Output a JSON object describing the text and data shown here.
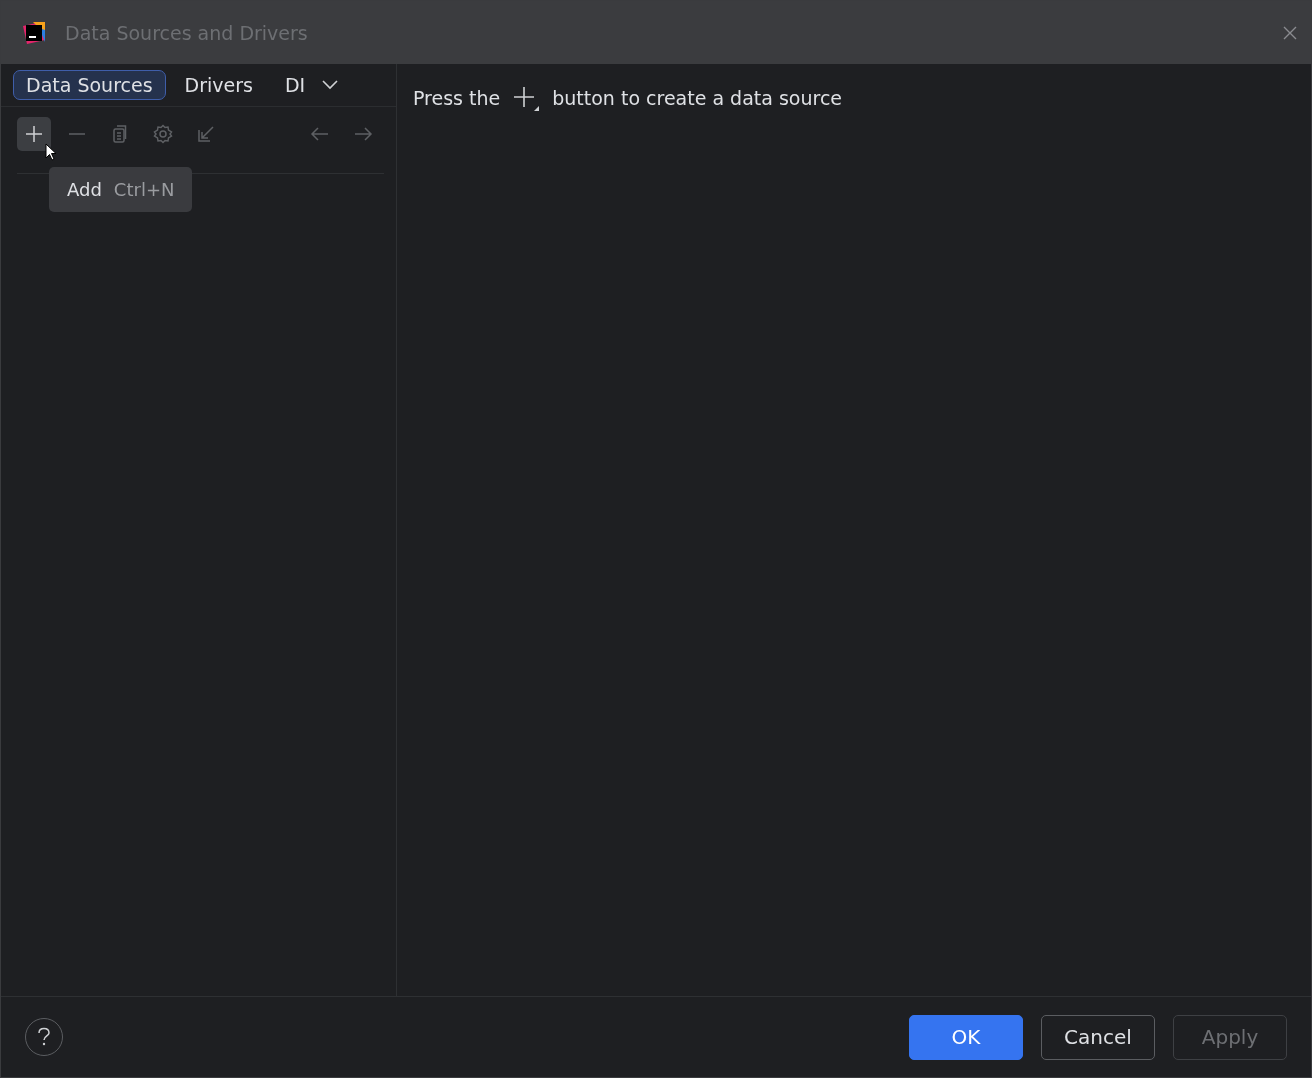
{
  "window": {
    "title": "Data Sources and Drivers"
  },
  "tabs": [
    {
      "label": "Data Sources",
      "selected": true
    },
    {
      "label": "Drivers",
      "selected": false
    },
    {
      "label": "DI",
      "selected": false
    }
  ],
  "toolbar": [
    {
      "kind": "add",
      "disabled": false,
      "hovered": true
    },
    {
      "kind": "remove",
      "disabled": true,
      "hovered": false
    },
    {
      "kind": "copy",
      "disabled": true,
      "hovered": false
    },
    {
      "kind": "settings",
      "disabled": true,
      "hovered": false
    },
    {
      "kind": "import",
      "disabled": true,
      "hovered": false
    },
    {
      "kind": "back",
      "disabled": true,
      "hovered": false
    },
    {
      "kind": "forward",
      "disabled": true,
      "hovered": false
    }
  ],
  "tooltip": {
    "label": "Add",
    "shortcut": "Ctrl+N"
  },
  "empty_state": {
    "before": "Press the",
    "after": "button to create a data source"
  },
  "buttons": [
    {
      "label": "OK",
      "kind": "primary",
      "disabled": false
    },
    {
      "label": "Cancel",
      "kind": "normal",
      "disabled": false
    },
    {
      "label": "Apply",
      "kind": "normal",
      "disabled": true
    }
  ]
}
